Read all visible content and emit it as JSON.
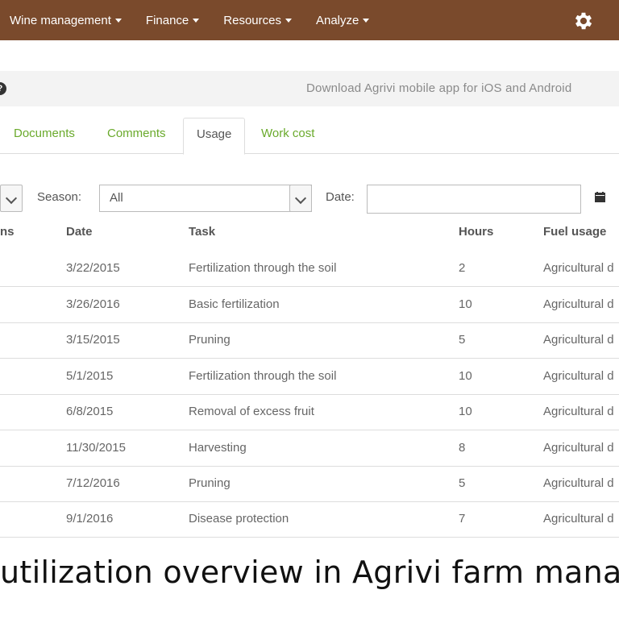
{
  "nav": {
    "items": [
      "Wine management",
      "Finance",
      "Resources",
      "Analyze"
    ]
  },
  "announce": {
    "help": "?",
    "text": "Download Agrivi mobile app for iOS and Android"
  },
  "tabs": [
    {
      "label": "Documents"
    },
    {
      "label": "Comments"
    },
    {
      "label": "Usage"
    },
    {
      "label": "Work cost"
    }
  ],
  "filters": {
    "season_label": "Season:",
    "season_value": "All",
    "date_label": "Date:",
    "date_value": ""
  },
  "table": {
    "headers": [
      "ns",
      "Date",
      "Task",
      "Hours",
      "Fuel usage"
    ],
    "rows": [
      {
        "date": "3/22/2015",
        "task": "Fertilization through the soil",
        "hours": "2",
        "fuel": "Agricultural d"
      },
      {
        "date": "3/26/2016",
        "task": "Basic fertilization",
        "hours": "10",
        "fuel": "Agricultural d"
      },
      {
        "date": "3/15/2015",
        "task": "Pruning",
        "hours": "5",
        "fuel": "Agricultural d"
      },
      {
        "date": "5/1/2015",
        "task": "Fertilization through the soil",
        "hours": "10",
        "fuel": "Agricultural d"
      },
      {
        "date": "6/8/2015",
        "task": "Removal of excess fruit",
        "hours": "10",
        "fuel": "Agricultural d"
      },
      {
        "date": "11/30/2015",
        "task": "Harvesting",
        "hours": "8",
        "fuel": "Agricultural d"
      },
      {
        "date": "7/12/2016",
        "task": "Pruning",
        "hours": "5",
        "fuel": "Agricultural d"
      },
      {
        "date": "9/1/2016",
        "task": "Disease protection",
        "hours": "7",
        "fuel": "Agricultural d"
      }
    ]
  },
  "caption": "utilization overview in Agrivi farm mana",
  "colors": {
    "nav_bg": "#7a4a2c",
    "tab_link": "#6aaa2c"
  },
  "icons": {
    "settings": "gear-icon",
    "calendar": "calendar-icon",
    "help": "help-icon"
  }
}
